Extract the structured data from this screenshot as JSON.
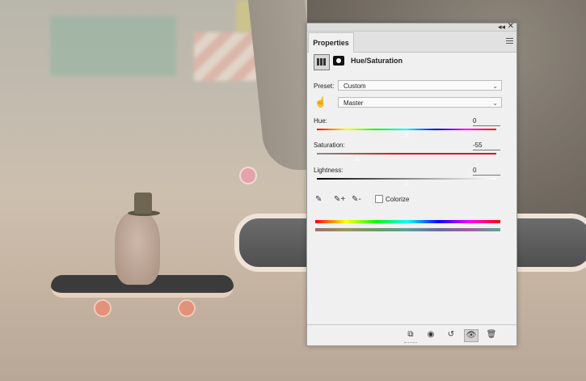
{
  "panel": {
    "tab_label": "Properties",
    "title": "Hue/Saturation",
    "preset_label": "Preset:",
    "preset_value": "Custom",
    "channel_value": "Master",
    "hue": {
      "label": "Hue:",
      "value": "0",
      "position": 0.5
    },
    "saturation": {
      "label": "Saturation:",
      "value": "-55",
      "position": 0.225
    },
    "lightness": {
      "label": "Lightness:",
      "value": "0",
      "position": 0.5
    },
    "colorize_label": "Colorize",
    "colorize_checked": false
  },
  "icons": {
    "collapse": "collapse-icon",
    "close": "close-icon",
    "panel_menu": "menu-icon",
    "adjustment": "hue-saturation-adjustment-icon",
    "mask": "mask-icon",
    "target_adjust": "hand-target-icon",
    "eyedropper": "eyedropper-icon",
    "eyedropper_add": "eyedropper-add-icon",
    "eyedropper_subtract": "eyedropper-subtract-icon",
    "clip": "clip-to-layer-icon",
    "view_previous": "view-previous-icon",
    "reset": "reset-icon",
    "visibility": "eye-icon",
    "delete": "trash-icon"
  },
  "colors": {
    "panel_bg": "#f0f0f0",
    "hue_track": "linear rainbow",
    "saturation_track": "#cc1f1f"
  }
}
